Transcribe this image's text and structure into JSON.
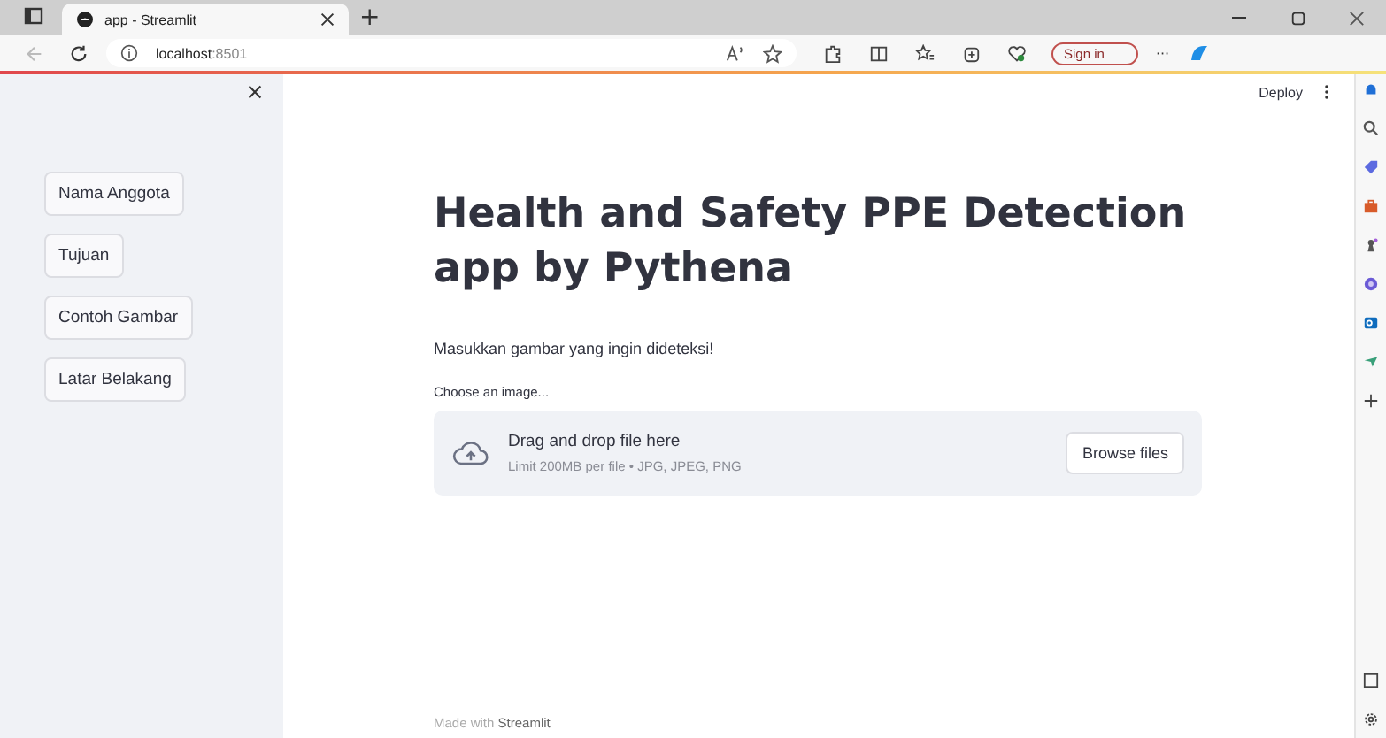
{
  "browser": {
    "tab": {
      "title": "app - Streamlit",
      "selected": true
    },
    "new_tab": "+",
    "address": "**localhost**:8501",
    "sign_in": "Sign in",
    "more": "···"
  },
  "app": {
    "deploy": "Deploy",
    "sidebar": {
      "buttons": [
        "Nama Anggota",
        "Tujuan",
        "Contoh Gambar",
        "Latar Belakang"
      ]
    },
    "title": "Health and Safety PPE Detection app by Pythena",
    "prompt": "Masukkan gambar yang ingin dideteksi!",
    "uploader": {
      "label": "Choose an image...",
      "drop_text": "Drag and drop file here",
      "limit": "Limit 200MB per file • JPG, JPEG, PNG",
      "button": "Browse files"
    },
    "footer": "Made with **Streamlit**"
  }
}
